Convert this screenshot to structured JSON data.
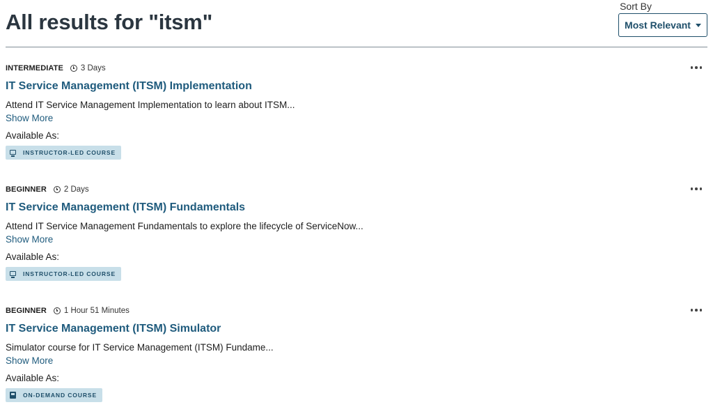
{
  "header": {
    "title": "All results for \"itsm\"",
    "sort_label": "Sort By",
    "sort_value": "Most Relevant"
  },
  "results": [
    {
      "level": "INTERMEDIATE",
      "duration": "3 Days",
      "title": "IT Service Management (ITSM) Implementation",
      "description": "Attend IT Service Management Implementation to learn about ITSM...",
      "show_more": "Show More",
      "available_label": "Available As:",
      "badge": "INSTRUCTOR-LED COURSE",
      "badge_icon": "monitor-icon"
    },
    {
      "level": "BEGINNER",
      "duration": "2 Days",
      "title": "IT Service Management (ITSM) Fundamentals",
      "description": "Attend IT Service Management Fundamentals to explore the lifecycle of ServiceNow...",
      "show_more": "Show More",
      "available_label": "Available As:",
      "badge": "INSTRUCTOR-LED COURSE",
      "badge_icon": "monitor-icon"
    },
    {
      "level": "BEGINNER",
      "duration": "1 Hour 51 Minutes",
      "title": "IT Service Management (ITSM) Simulator",
      "description": "Simulator course for IT Service Management (ITSM) Fundame...",
      "show_more": "Show More",
      "available_label": "Available As:",
      "badge": "ON-DEMAND COURSE",
      "badge_icon": "book-icon"
    }
  ],
  "colors": {
    "accent": "#1f5b7d",
    "badge_bg": "#c8dfe9",
    "title": "#2b3640"
  }
}
